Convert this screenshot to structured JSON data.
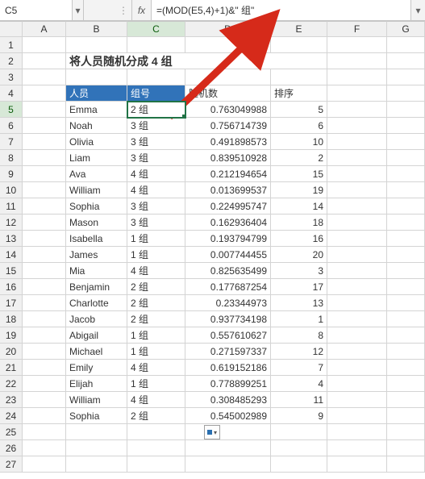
{
  "formula_bar": {
    "name_box": "C5",
    "fx_label": "fx",
    "formula": "=(MOD(E5,4)+1)&\" 组\""
  },
  "columns": [
    "A",
    "B",
    "C",
    "D",
    "E",
    "F",
    "G"
  ],
  "title": "将人员随机分成 4 组",
  "headers": {
    "person": "人员",
    "group": "组号",
    "rand": "随机数",
    "rank": "排序"
  },
  "rows": [
    {
      "r": 5,
      "person": "Emma",
      "group": "2 组",
      "rand": "0.763049988",
      "rank": "5"
    },
    {
      "r": 6,
      "person": "Noah",
      "group": "3 组",
      "rand": "0.756714739",
      "rank": "6"
    },
    {
      "r": 7,
      "person": "Olivia",
      "group": "3 组",
      "rand": "0.491898573",
      "rank": "10"
    },
    {
      "r": 8,
      "person": "Liam",
      "group": "3 组",
      "rand": "0.839510928",
      "rank": "2"
    },
    {
      "r": 9,
      "person": "Ava",
      "group": "4 组",
      "rand": "0.212194654",
      "rank": "15"
    },
    {
      "r": 10,
      "person": "William",
      "group": "4 组",
      "rand": "0.013699537",
      "rank": "19"
    },
    {
      "r": 11,
      "person": "Sophia",
      "group": "3 组",
      "rand": "0.224995747",
      "rank": "14"
    },
    {
      "r": 12,
      "person": "Mason",
      "group": "3 组",
      "rand": "0.162936404",
      "rank": "18"
    },
    {
      "r": 13,
      "person": "Isabella",
      "group": "1 组",
      "rand": "0.193794799",
      "rank": "16"
    },
    {
      "r": 14,
      "person": "James",
      "group": "1 组",
      "rand": "0.007744455",
      "rank": "20"
    },
    {
      "r": 15,
      "person": "Mia",
      "group": "4 组",
      "rand": "0.825635499",
      "rank": "3"
    },
    {
      "r": 16,
      "person": "Benjamin",
      "group": "2 组",
      "rand": "0.177687254",
      "rank": "17"
    },
    {
      "r": 17,
      "person": "Charlotte",
      "group": "2 组",
      "rand": "0.23344973",
      "rank": "13"
    },
    {
      "r": 18,
      "person": "Jacob",
      "group": "2 组",
      "rand": "0.937734198",
      "rank": "1"
    },
    {
      "r": 19,
      "person": "Abigail",
      "group": "1 组",
      "rand": "0.557610627",
      "rank": "8"
    },
    {
      "r": 20,
      "person": "Michael",
      "group": "1 组",
      "rand": "0.271597337",
      "rank": "12"
    },
    {
      "r": 21,
      "person": "Emily",
      "group": "4 组",
      "rand": "0.619152186",
      "rank": "7"
    },
    {
      "r": 22,
      "person": "Elijah",
      "group": "1 组",
      "rand": "0.778899251",
      "rank": "4"
    },
    {
      "r": 23,
      "person": "William",
      "group": "4 组",
      "rand": "0.308485293",
      "rank": "11"
    },
    {
      "r": 24,
      "person": "Sophia",
      "group": "2 组",
      "rand": "0.545002989",
      "rank": "9"
    }
  ],
  "empty_rows": [
    25,
    26,
    27
  ],
  "selected_cell": "C5"
}
